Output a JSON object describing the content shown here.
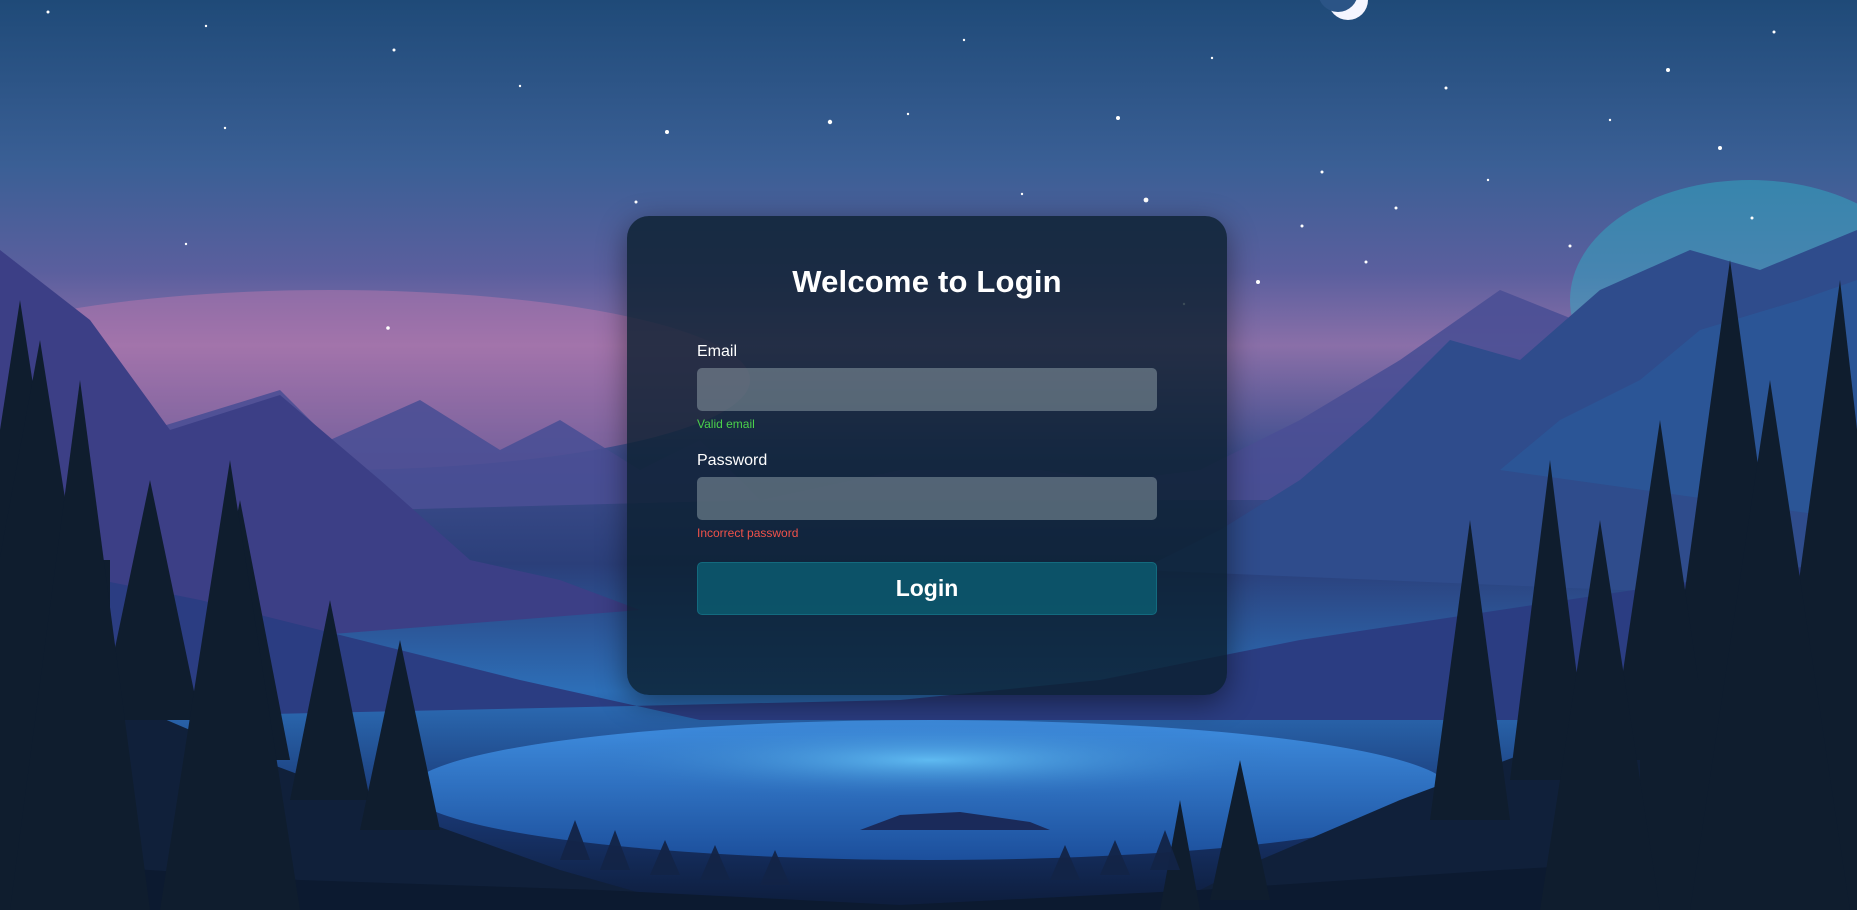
{
  "login": {
    "title": "Welcome to Login",
    "email": {
      "label": "Email",
      "value": "",
      "placeholder": "",
      "status_message": "Valid email",
      "status_color": "#4bd14b"
    },
    "password": {
      "label": "Password",
      "value": "",
      "placeholder": "",
      "status_message": "Incorrect password",
      "status_color": "#f0524a"
    },
    "submit_label": "Login"
  },
  "colors": {
    "card_background": "#0a1e2d",
    "button_background": "#0c5a70",
    "title_text": "#ffffff"
  },
  "background": {
    "scene": "night mountain lake landscape with starry sky, crescent moon, pine tree silhouettes"
  }
}
